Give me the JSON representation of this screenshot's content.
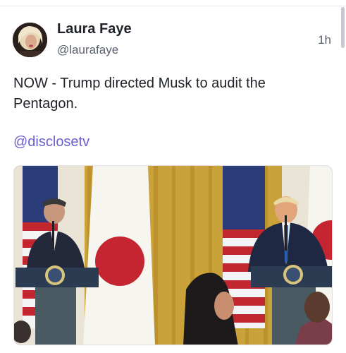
{
  "post": {
    "author": {
      "display_name": "Laura Faye",
      "handle": "@laurafaye",
      "avatar_icon": "profile-photo"
    },
    "timestamp": "1h",
    "text": "NOW - Trump directed Musk to audit the Pentagon.",
    "mention": "@disclosetv",
    "media": {
      "type": "press-conference-photo",
      "icon": "photo"
    }
  },
  "colors": {
    "link": "#6b5fd0",
    "text": "#1f2328",
    "muted": "#59606b"
  }
}
